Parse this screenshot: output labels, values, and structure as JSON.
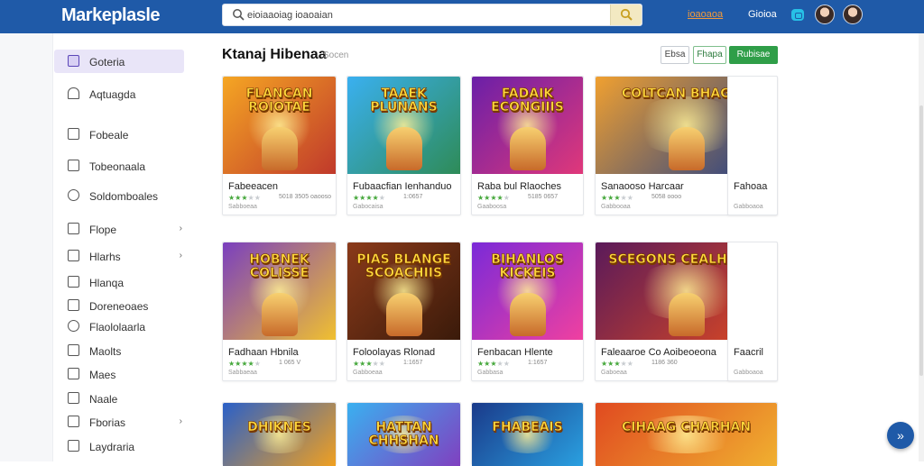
{
  "app": {
    "brand": "Markeplasle"
  },
  "search": {
    "placeholder": "",
    "value": "eioiaaoiag ioaoaian"
  },
  "topbar": {
    "link1": "ioaoaoa",
    "link2": "Gioioa"
  },
  "sidebar": {
    "items": [
      {
        "label": "Goteria",
        "icon": "square-icon",
        "active": true
      },
      {
        "label": "Aqtuagda",
        "icon": "home-icon"
      },
      {
        "label": "Fobeale",
        "icon": "doc-icon"
      },
      {
        "label": "Tobeonaala",
        "icon": "calendar-icon"
      },
      {
        "label": "Soldomboales",
        "icon": "shield-icon"
      },
      {
        "label": "Flope",
        "icon": "doc-icon",
        "chevron": "›"
      },
      {
        "label": "Hlarhs",
        "icon": "list-icon",
        "chevron": "›"
      },
      {
        "label": "Hlanqa",
        "icon": "puzzle-icon"
      },
      {
        "label": "Doreneoaes",
        "icon": "briefcase-icon"
      },
      {
        "label": "Flaololaarla",
        "icon": "pin-icon"
      },
      {
        "label": "Maolts",
        "icon": "gear-icon"
      },
      {
        "label": "Maes",
        "icon": "file-icon"
      },
      {
        "label": "Naale",
        "icon": "play-icon"
      },
      {
        "label": "Fborias",
        "icon": "people-icon",
        "chevron": "›"
      },
      {
        "label": "Laydraria",
        "icon": "chart-icon"
      }
    ]
  },
  "content": {
    "title": "Ktanaj Hibenaa",
    "subtitle": "Socen",
    "buttons": [
      "Ebsa",
      "Fhapa",
      "Rubisae"
    ]
  },
  "cards": [
    {
      "name": "Fabeeacen",
      "thumb_title": "FLANCAN ROIOTAE",
      "stars": 3,
      "meta": "Sabboeaa",
      "metar": "5018 3505 oaooso",
      "colors": [
        "#f5a623",
        "#c0392b"
      ]
    },
    {
      "name": "Fubaacfian Ienhanduo",
      "thumb_title": "TAAEK PLUNANS",
      "stars": 4,
      "meta": "Gabocaisa",
      "metar": "1:0657",
      "colors": [
        "#3ab0f0",
        "#2e8b57"
      ]
    },
    {
      "name": "Raba bul Rlaoches",
      "thumb_title": "FADAIK ECONGIIIS",
      "stars": 4,
      "meta": "Gaaboosa",
      "metar": "5185 0657",
      "colors": [
        "#6a1fa8",
        "#e0387a"
      ]
    },
    {
      "name": "Sanaooso Harcaar",
      "thumb_title": "COLTCAN BHAGAI!",
      "stars": 3,
      "meta": "Gabbooaa",
      "metar": "5058  oooo",
      "colors": [
        "#f0a030",
        "#1d3c8a"
      ]
    },
    {
      "name": "Fahoaa",
      "thumb_title": "",
      "stars": 0,
      "meta": "Gabboaoa",
      "metar": "",
      "colors": [
        "#ffffff",
        "#ffffff"
      ]
    },
    {
      "name": "Fadhaan Hbnila",
      "thumb_title": "HOBNEK COLISSE",
      "stars": 4,
      "meta": "Sabbaeaa",
      "metar": "1 065 V",
      "colors": [
        "#7a3fbf",
        "#f0c030"
      ]
    },
    {
      "name": "Foloolayas Rlonad",
      "thumb_title": "PIAS BLANGE SCOACHIIS",
      "stars": 3,
      "meta": "Gabboeaa",
      "metar": "1:1657",
      "colors": [
        "#8a3a1a",
        "#3a1a0a"
      ]
    },
    {
      "name": "Fenbacan Hlente",
      "thumb_title": "BIHANLOS KICKEIS",
      "stars": 3,
      "meta": "Gabbasa",
      "metar": "1:1657",
      "colors": [
        "#7a2ad8",
        "#f040a0"
      ]
    },
    {
      "name": "Faleaaroe Co Aoibeoeona",
      "thumb_title": "SCEGONS CEALHIPEIB",
      "stars": 3,
      "meta": "Gaboeaa",
      "metar": "1186 360",
      "colors": [
        "#5a1a5a",
        "#e04a20"
      ]
    },
    {
      "name": "Faacril",
      "thumb_title": "",
      "stars": 0,
      "meta": "Gabboaoa",
      "metar": "",
      "colors": [
        "#ffffff",
        "#ffffff"
      ]
    },
    {
      "name": "",
      "thumb_title": "DHIKNES",
      "stars": 0,
      "meta": "",
      "metar": "",
      "colors": [
        "#2a60c8",
        "#f0a020"
      ]
    },
    {
      "name": "",
      "thumb_title": "HATTAN CHHSHAN",
      "stars": 0,
      "meta": "",
      "metar": "",
      "colors": [
        "#3ab0f0",
        "#8040c0"
      ]
    },
    {
      "name": "",
      "thumb_title": "FHABEAIS",
      "stars": 0,
      "meta": "",
      "metar": "",
      "colors": [
        "#1a3a8a",
        "#2aa0e0"
      ]
    },
    {
      "name": "",
      "thumb_title": "CIHAAG CHARHAN",
      "stars": 0,
      "meta": "",
      "metar": "",
      "colors": [
        "#e04a20",
        "#f0b030"
      ]
    }
  ],
  "fab": {
    "icon": "double-chevron-icon",
    "glyph": "»"
  }
}
